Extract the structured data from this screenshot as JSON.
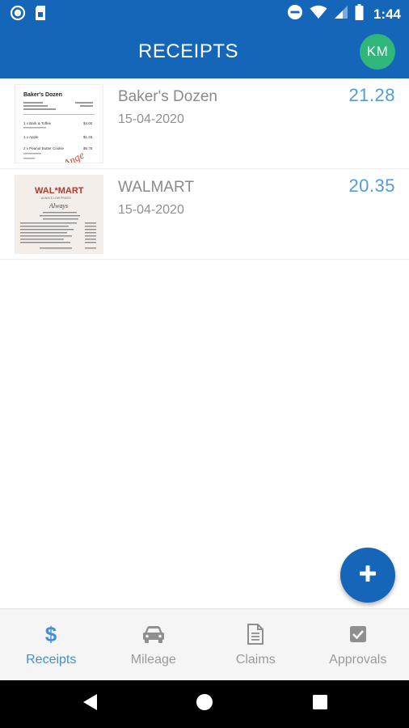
{
  "status_bar": {
    "time": "1:44",
    "icons": [
      "notification-circle-icon",
      "sim-card-icon",
      "do-not-disturb-icon",
      "wifi-icon",
      "cell-signal-icon",
      "battery-icon"
    ]
  },
  "app_bar": {
    "title": "RECEIPTS",
    "avatar_initials": "KM"
  },
  "receipts": [
    {
      "merchant": "Baker's Dozen",
      "date": "15-04-2020",
      "amount": "21.28",
      "thumbnail": {
        "header": "Baker's Dozen",
        "lines": [
          "1 x Bark & Toffee",
          "1 x Apple",
          "2 x Peanut Butter Cookie"
        ],
        "prices": [
          "$4.00",
          "$1.25",
          "$6.75"
        ],
        "stamp": "Ange"
      }
    },
    {
      "merchant": "WALMART",
      "date": "15-04-2020",
      "amount": "20.35",
      "thumbnail": {
        "header": "WAL*MART",
        "sub": "ALWAYS LOW PRICES",
        "stamp": "Always"
      }
    }
  ],
  "fab": {
    "icon": "plus-icon"
  },
  "bottom_nav": [
    {
      "label": "Receipts",
      "icon": "dollar-icon",
      "active": true
    },
    {
      "label": "Mileage",
      "icon": "car-icon",
      "active": false
    },
    {
      "label": "Claims",
      "icon": "document-icon",
      "active": false
    },
    {
      "label": "Approvals",
      "icon": "checkbox-icon",
      "active": false
    }
  ],
  "colors": {
    "primary": "#1565b8",
    "avatar": "#2fb67a",
    "amount": "#4f9be0",
    "nav_active": "#3f8ee0",
    "nav_inactive": "#9a9a9a"
  }
}
